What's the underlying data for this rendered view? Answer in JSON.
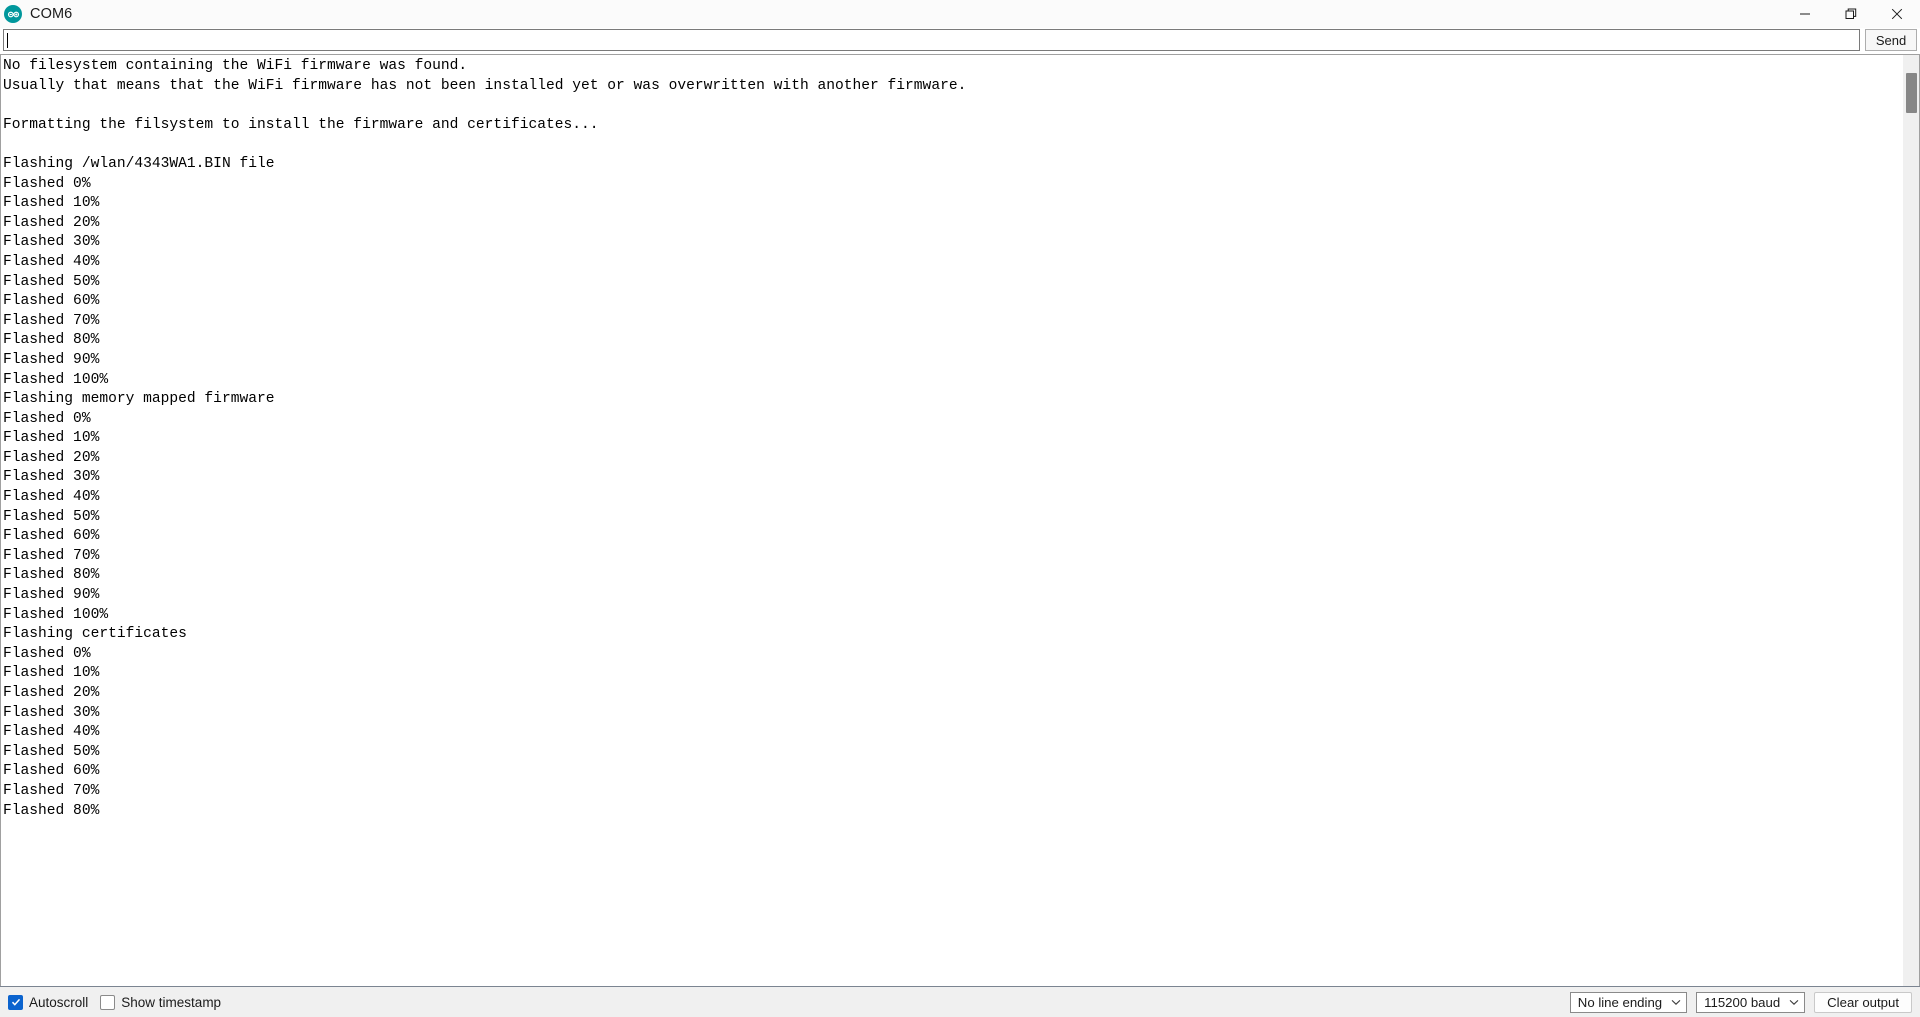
{
  "window": {
    "title": "COM6",
    "icon": "arduino-logo-icon",
    "controls": {
      "minimize": "minimize-icon",
      "restore": "restore-icon",
      "close": "close-icon"
    }
  },
  "send_row": {
    "input_value": "",
    "input_placeholder": "",
    "send_label": "Send"
  },
  "output": {
    "text": "No filesystem containing the WiFi firmware was found.\nUsually that means that the WiFi firmware has not been installed yet or was overwritten with another firmware.\n\nFormatting the filsystem to install the firmware and certificates...\n\nFlashing /wlan/4343WA1.BIN file\nFlashed 0%\nFlashed 10%\nFlashed 20%\nFlashed 30%\nFlashed 40%\nFlashed 50%\nFlashed 60%\nFlashed 70%\nFlashed 80%\nFlashed 90%\nFlashed 100%\nFlashing memory mapped firmware\nFlashed 0%\nFlashed 10%\nFlashed 20%\nFlashed 30%\nFlashed 40%\nFlashed 50%\nFlashed 60%\nFlashed 70%\nFlashed 80%\nFlashed 90%\nFlashed 100%\nFlashing certificates\nFlashed 0%\nFlashed 10%\nFlashed 20%\nFlashed 30%\nFlashed 40%\nFlashed 50%\nFlashed 60%\nFlashed 70%\nFlashed 80%",
    "lines": [
      "No filesystem containing the WiFi firmware was found.",
      "Usually that means that the WiFi firmware has not been installed yet or was overwritten with another firmware.",
      "",
      "Formatting the filsystem to install the firmware and certificates...",
      "",
      "Flashing /wlan/4343WA1.BIN file",
      "Flashed 0%",
      "Flashed 10%",
      "Flashed 20%",
      "Flashed 30%",
      "Flashed 40%",
      "Flashed 50%",
      "Flashed 60%",
      "Flashed 70%",
      "Flashed 80%",
      "Flashed 90%",
      "Flashed 100%",
      "Flashing memory mapped firmware",
      "Flashed 0%",
      "Flashed 10%",
      "Flashed 20%",
      "Flashed 30%",
      "Flashed 40%",
      "Flashed 50%",
      "Flashed 60%",
      "Flashed 70%",
      "Flashed 80%",
      "Flashed 90%",
      "Flashed 100%",
      "Flashing certificates",
      "Flashed 0%",
      "Flashed 10%",
      "Flashed 20%",
      "Flashed 30%",
      "Flashed 40%",
      "Flashed 50%",
      "Flashed 60%",
      "Flashed 70%",
      "Flashed 80%"
    ]
  },
  "status_bar": {
    "autoscroll": {
      "label": "Autoscroll",
      "checked": true
    },
    "show_timestamp": {
      "label": "Show timestamp",
      "checked": false
    },
    "line_ending": {
      "selected": "No line ending"
    },
    "baud_rate": {
      "selected": "115200 baud"
    },
    "clear_output_label": "Clear output"
  },
  "colors": {
    "accent": "#0b63ce",
    "arduino_teal": "#00979c",
    "titlebar_bg": "#fbfbfb",
    "statusbar_bg": "#f0f0f0",
    "output_bg": "#ffffff",
    "text": "#000000",
    "scrollbar_thumb": "#878787"
  }
}
